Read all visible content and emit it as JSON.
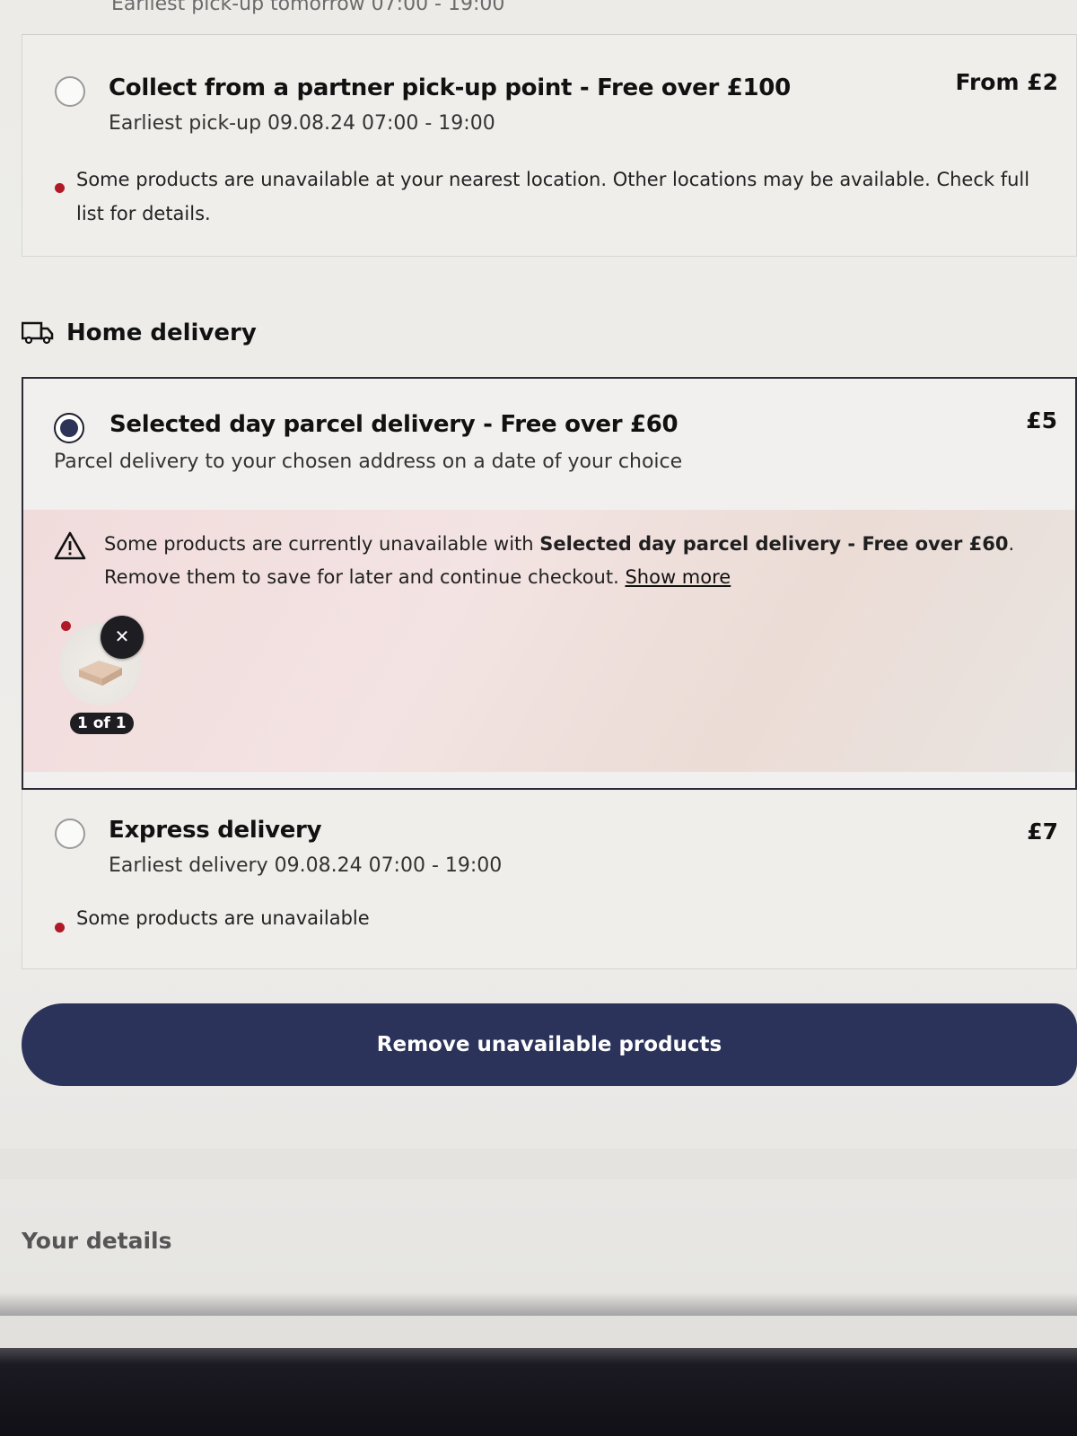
{
  "top_fragment": "Earliest pick-up tomorrow 07:00 - 19:00",
  "pickup_option": {
    "title": "Collect from a partner pick-up point - Free over £100",
    "subtitle": "Earliest pick-up 09.08.24 07:00 - 19:00",
    "price": "From £2",
    "notice": "Some products are unavailable at your nearest location. Other locations may be available. Check full list for details."
  },
  "home_delivery": {
    "heading": "Home delivery",
    "icon": "truck-icon"
  },
  "selected_option": {
    "title": "Selected day parcel delivery - Free over £60",
    "subtitle": "Parcel delivery to your chosen address on a date of your choice",
    "price": "£5",
    "warning": {
      "text_before": "Some products are currently unavailable with ",
      "text_bold": "Selected day parcel delivery - Free over £60",
      "text_after": ". Remove them to save for later and continue checkout. ",
      "link": "Show more"
    },
    "remove_icon": "close-icon",
    "counter": "1 of 1"
  },
  "express_option": {
    "title": "Express delivery",
    "subtitle": "Earliest delivery 09.08.24 07:00 - 19:00",
    "price": "£7",
    "notice": "Some products are unavailable"
  },
  "cta_label": "Remove unavailable products",
  "details_heading": "Your details"
}
